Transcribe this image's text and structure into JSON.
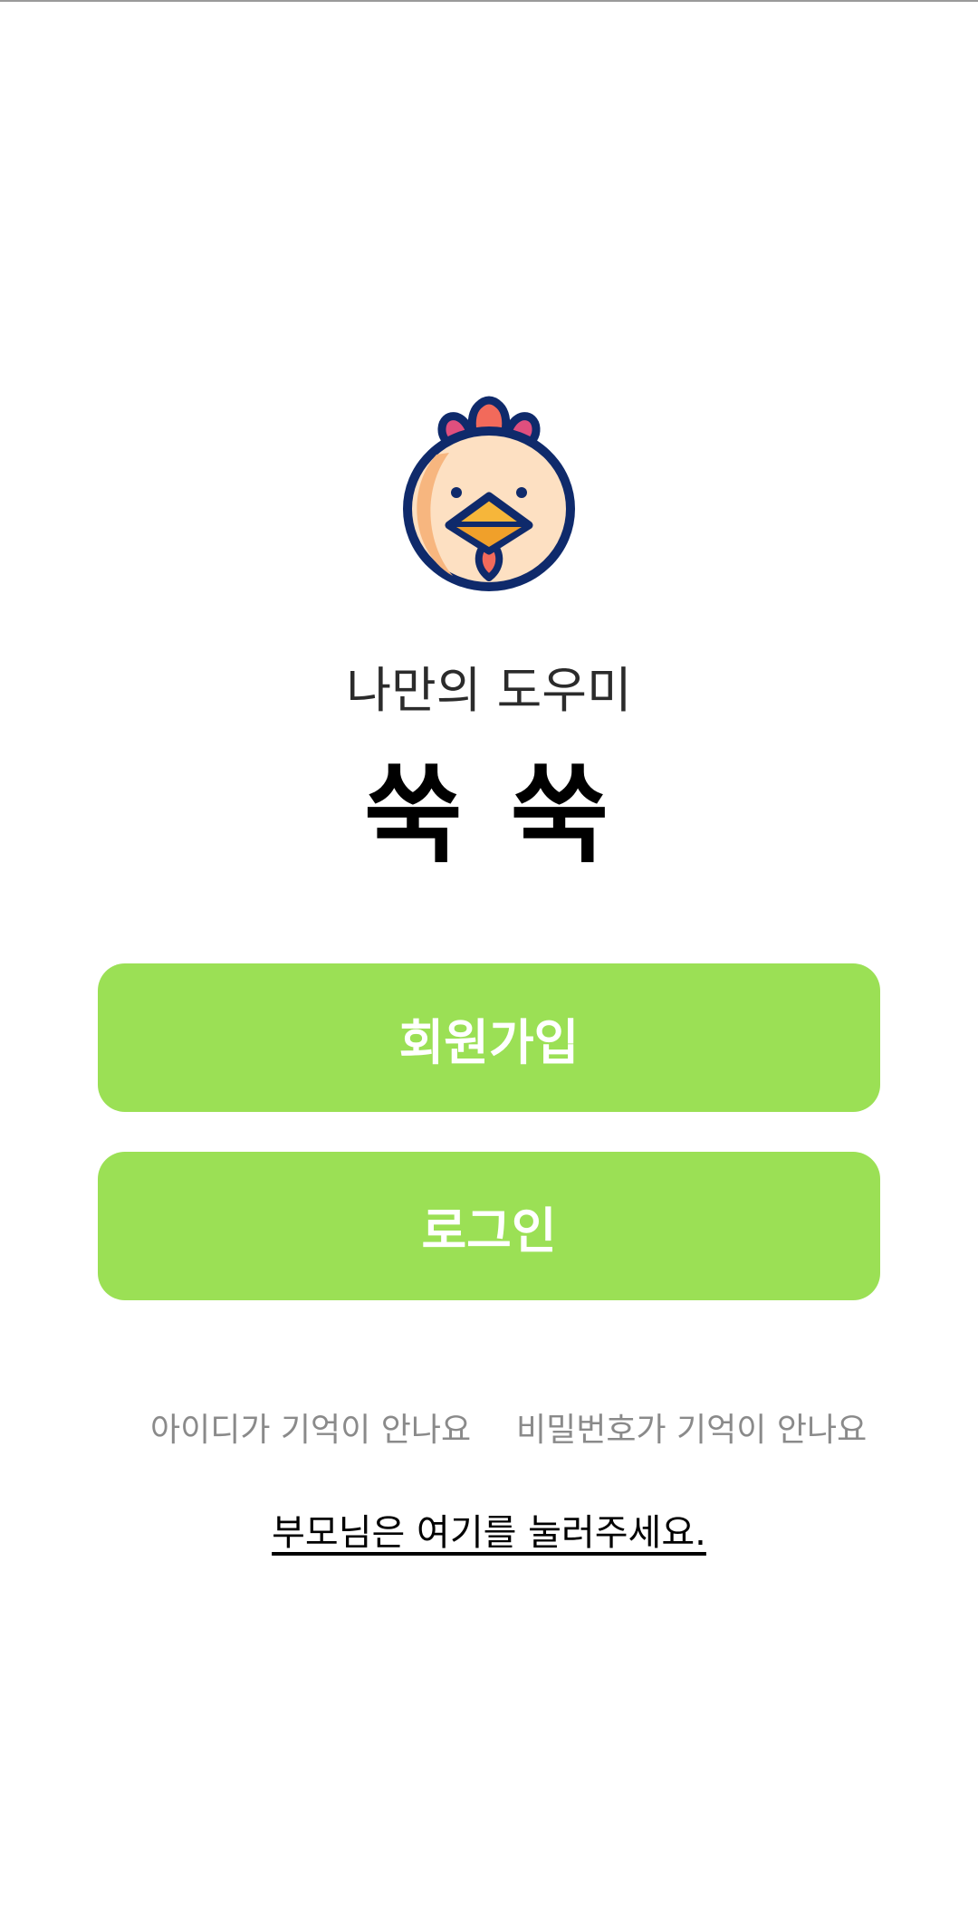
{
  "app": {
    "subtitle": "나만의 도우미",
    "title": "쑥 쑥"
  },
  "buttons": {
    "signup_label": "회원가입",
    "login_label": "로그인"
  },
  "help": {
    "forgot_id": "아이디가 기억이 안나요",
    "forgot_password": "비밀번호가 기억이 안나요"
  },
  "parents": {
    "link_text": "부모님은 여기를 눌러주세요."
  },
  "colors": {
    "accent_green": "#9be055",
    "mascot_outline": "#0f2a6b",
    "mascot_face": "#fde0c2",
    "mascot_cheek": "#f7b67f",
    "mascot_comb": "#f26a5b",
    "mascot_comb_side": "#e04f7e",
    "mascot_beak": "#f6b63a"
  },
  "icons": {
    "mascot": "chick-mascot-icon"
  }
}
